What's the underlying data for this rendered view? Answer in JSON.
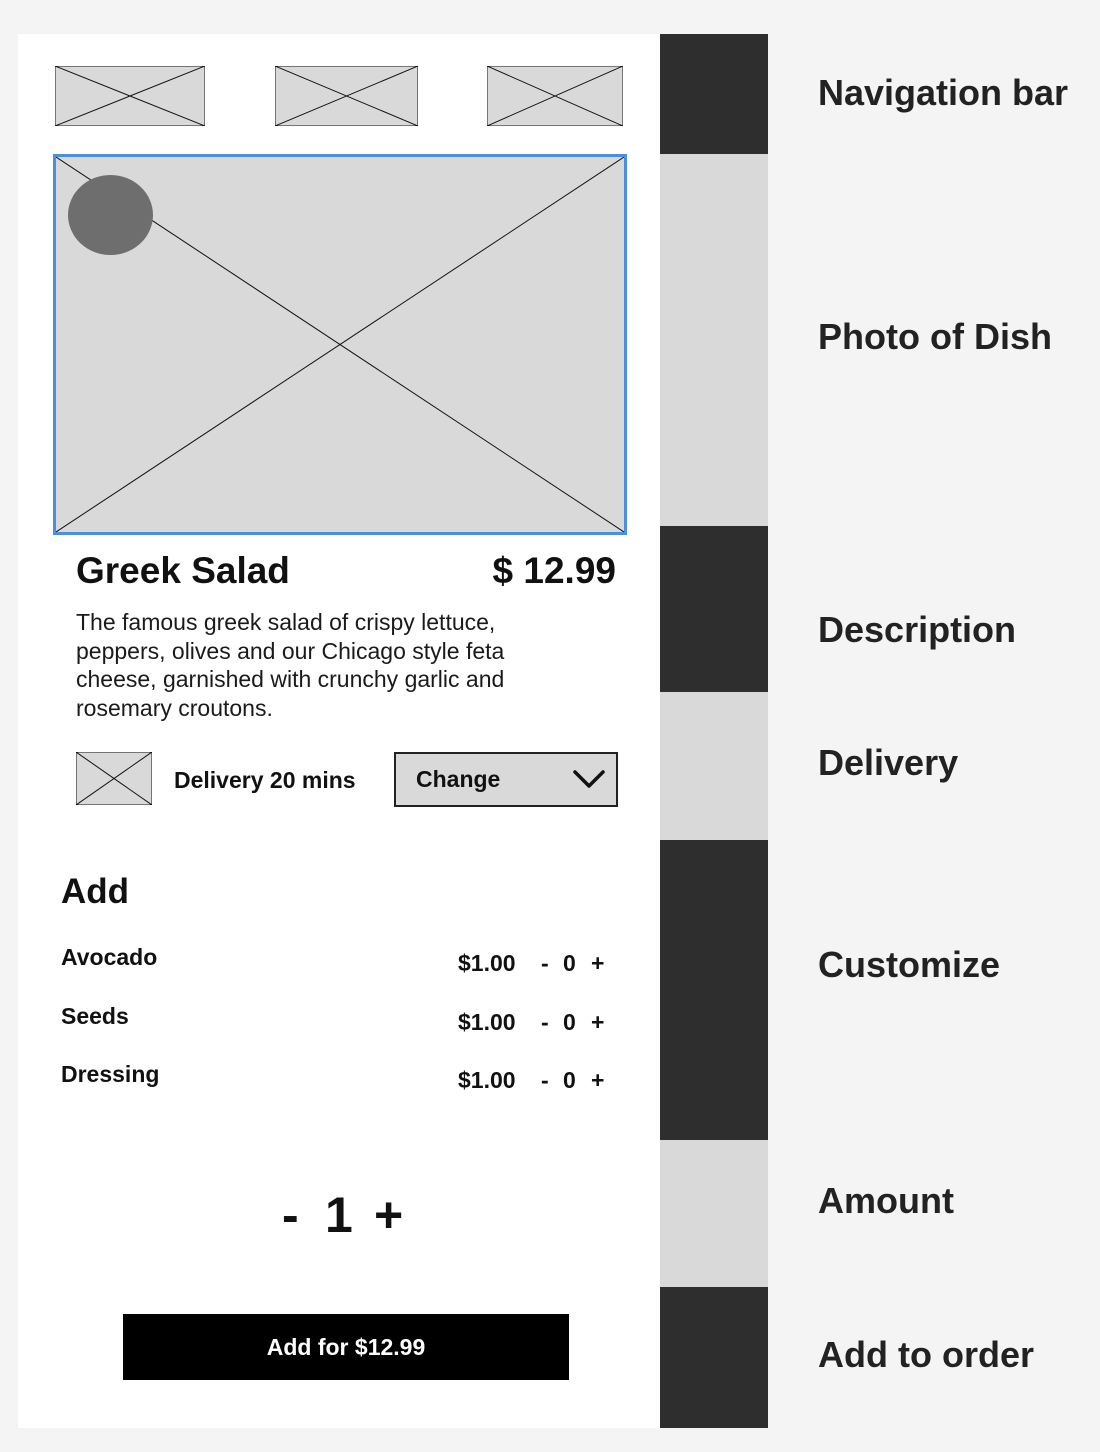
{
  "dish": {
    "title": "Greek Salad",
    "price": "$ 12.99",
    "description": "The famous greek salad of crispy lettuce, peppers, olives and our Chicago style feta cheese, garnished with crunchy garlic and rosemary croutons."
  },
  "delivery": {
    "text": "Delivery 20 mins",
    "change_label": "Change"
  },
  "addons": {
    "heading": "Add",
    "items": [
      {
        "name": "Avocado",
        "price": "$1.00",
        "minus": "-",
        "qty": "0",
        "plus": "+"
      },
      {
        "name": "Seeds",
        "price": "$1.00",
        "minus": "-",
        "qty": "0",
        "plus": "+"
      },
      {
        "name": "Dressing",
        "price": "$1.00",
        "minus": "-",
        "qty": "0",
        "plus": "+"
      }
    ]
  },
  "amount": {
    "minus": "-",
    "value": "1",
    "plus": "+"
  },
  "order_button": {
    "label": "Add for $12.99"
  },
  "annotations": {
    "items": [
      {
        "label": "Navigation bar"
      },
      {
        "label": "Photo of Dish"
      },
      {
        "label": "Description"
      },
      {
        "label": "Delivery"
      },
      {
        "label": "Customize"
      },
      {
        "label": "Amount"
      },
      {
        "label": "Add to order"
      }
    ]
  },
  "colors": {
    "band_dark": "#2e2e2e",
    "band_light": "#d9d9d9",
    "placeholder": "#d9d9d9",
    "photo_border": "#4a90e2",
    "button": "#000000"
  }
}
